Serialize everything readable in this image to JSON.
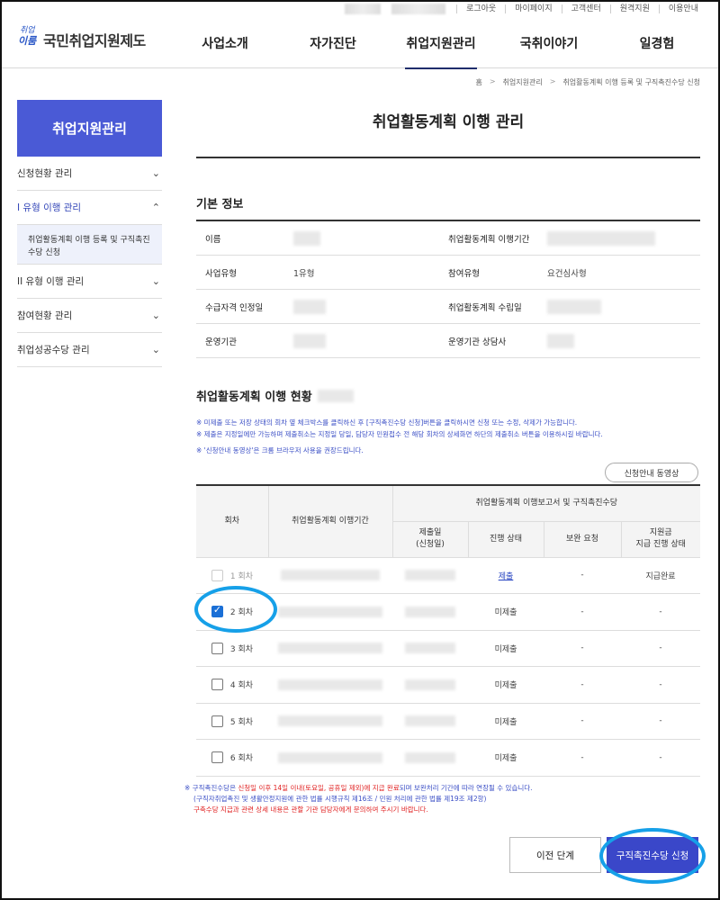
{
  "util_links": [
    "로그아웃",
    "마이페이지",
    "고객센터",
    "원격지원",
    "이용안내"
  ],
  "logo": {
    "mark_top": "취업",
    "mark_bottom": "이룸",
    "text": "국민취업지원제도"
  },
  "gnb": [
    "사업소개",
    "자가진단",
    "취업지원관리",
    "국취이야기",
    "일경험"
  ],
  "breadcrumb": [
    "홈",
    "취업지원관리",
    "취업활동계획 이행 등록 및 구직촉진수당 신청"
  ],
  "sidebar": {
    "title": "취업지원관리",
    "items": [
      "신청현황 관리",
      "I 유형 이행 관리",
      "II 유형 이행 관리",
      "참여현황 관리",
      "취업성공수당 관리"
    ],
    "sub_item": "취업활동계획 이행 등록 및 구직촉진수당 신청"
  },
  "page_title": "취업활동계획 이행 관리",
  "basic": {
    "title": "기본 정보",
    "rows": [
      {
        "k1": "이름",
        "v1": "",
        "k2": "취업활동계획 이행기간",
        "v2": ""
      },
      {
        "k1": "사업유형",
        "v1": "1유형",
        "k2": "참여유형",
        "v2": "요건심사형"
      },
      {
        "k1": "수급자격 인정일",
        "v1": "",
        "k2": "취업활동계획 수립일",
        "v2": ""
      },
      {
        "k1": "운영기관",
        "v1": "",
        "k2": "운영기관 상담사",
        "v2": ""
      }
    ]
  },
  "status": {
    "title": "취업활동계획 이행 현황",
    "notes": [
      "※ 미제출 또는 저장 상태의 회차 옆 체크박스를 클릭하신 후 [구직촉진수당 신청]버튼을 클릭하시면 신청 또는 수정, 삭제가 가능합니다.",
      "※ 제출은 지정일에만 가능하며 제출취소는 지정일 당일, 담당자 민원접수 전 해당 회차의 상세화면 하단의 제출취소 버튼을 이용하시길 바랍니다.",
      "※ '신청안내 동영상'은 크롬 브라우저 사용을 권장드립니다."
    ],
    "guide_button": "신청안내 동영상"
  },
  "table": {
    "h_round": "회차",
    "h_period": "취업활동계획 이행기간",
    "h_group": "취업활동계획 이행보고서 및 구직촉진수당",
    "h_submit_1": "제출일",
    "h_submit_2": "(신청일)",
    "h_status": "진행 상태",
    "h_request": "보완 요청",
    "h_pay_1": "지원금",
    "h_pay_2": "지급 진행 상태",
    "rows": [
      {
        "round": "1 회차",
        "status": "제출",
        "request": "-",
        "pay": "지급완료"
      },
      {
        "round": "2 회차",
        "status": "미제출",
        "request": "-",
        "pay": "-"
      },
      {
        "round": "3 회차",
        "status": "미제출",
        "request": "-",
        "pay": "-"
      },
      {
        "round": "4 회차",
        "status": "미제출",
        "request": "-",
        "pay": "-"
      },
      {
        "round": "5 회차",
        "status": "미제출",
        "request": "-",
        "pay": "-"
      },
      {
        "round": "6 회차",
        "status": "미제출",
        "request": "-",
        "pay": "-"
      }
    ]
  },
  "foot": {
    "l1_a": "※ 구직촉진수당은 ",
    "l1_red": "신청일 이후 14일 이내(토요일, 공휴일 제외)에 지급 완료",
    "l1_b": "되며 보완처리 기간에 따라 연장될 수 있습니다.",
    "l2": "(구직자취업촉진 및 생활안정지원에 관한 법률 시행규칙 제16조 / 민원 처리에 관한 법률 제19조 제2항)",
    "l3": "구축수당 지급과 관련 상세 내용은 관할 기관 담당자에게 문의하여 주시기 바랍니다."
  },
  "buttons": {
    "prev": "이전 단계",
    "apply": "구직촉진수당 신청"
  },
  "colors": {
    "accent": "#3a47c9",
    "sidebar_title": "#4a5ad6",
    "note_blue": "#3b4fc6",
    "note_red": "#e02020",
    "highlight": "#16a0e8"
  }
}
